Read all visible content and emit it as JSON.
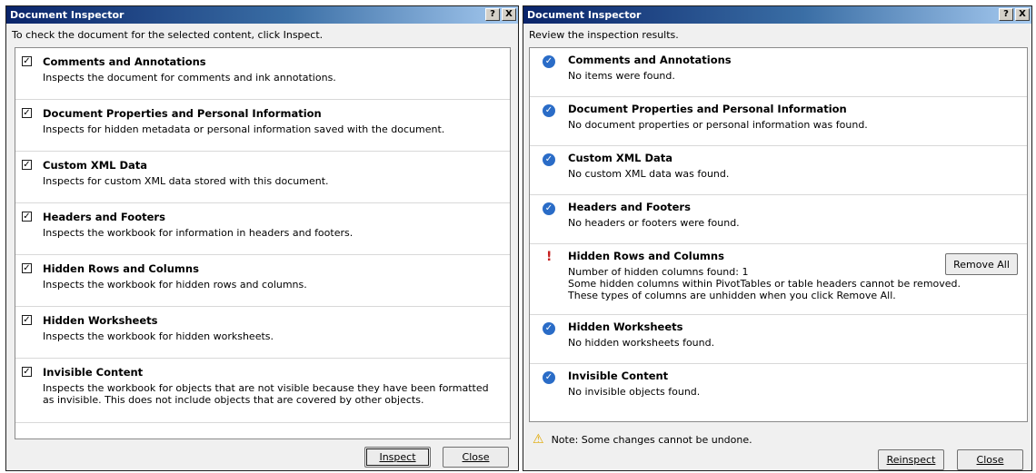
{
  "left_dialog": {
    "title": "Document Inspector",
    "help_btn": "?",
    "close_x": "X",
    "instruction": "To check the document for the selected content, click Inspect.",
    "items": [
      {
        "heading": "Comments and Annotations",
        "desc": "Inspects the document for comments and ink annotations."
      },
      {
        "heading": "Document Properties and Personal Information",
        "desc": "Inspects for hidden metadata or personal information saved with the document."
      },
      {
        "heading": "Custom XML Data",
        "desc": "Inspects for custom XML data stored with this document."
      },
      {
        "heading": "Headers and Footers",
        "desc": "Inspects the workbook for information in headers and footers."
      },
      {
        "heading": "Hidden Rows and Columns",
        "desc": "Inspects the workbook for hidden rows and columns."
      },
      {
        "heading": "Hidden Worksheets",
        "desc": "Inspects the workbook for hidden worksheets."
      },
      {
        "heading": "Invisible Content",
        "desc": "Inspects the workbook for objects that are not visible because they have been formatted as invisible. This does not include objects that are covered by other objects."
      }
    ],
    "check_mark": "✓",
    "inspect_label": "Inspect",
    "close_label": "Close"
  },
  "right_dialog": {
    "title": "Document Inspector",
    "help_btn": "?",
    "close_x": "X",
    "instruction": "Review the inspection results.",
    "items": [
      {
        "heading": "Comments and Annotations",
        "desc": "No items were found."
      },
      {
        "heading": "Document Properties and Personal Information",
        "desc": "No document properties or personal information was found."
      },
      {
        "heading": "Custom XML Data",
        "desc": "No custom XML data was found."
      },
      {
        "heading": "Headers and Footers",
        "desc": "No headers or footers were found."
      },
      {
        "heading": "Hidden Rows and Columns",
        "desc1": "Number of hidden columns found: 1",
        "desc2": "Some hidden columns within PivotTables or table headers cannot be removed.",
        "desc3": "These types of columns are unhidden when you click Remove All."
      },
      {
        "heading": "Hidden Worksheets",
        "desc": "No hidden worksheets found."
      },
      {
        "heading": "Invisible Content",
        "desc": "No invisible objects found."
      }
    ],
    "ok_mark": "✓",
    "warn_mark": "!",
    "remove_all_label": "Remove All",
    "note_icon": "⚠",
    "note": "Note: Some changes cannot be undone.",
    "reinspect_label": "Reinspect",
    "close_label": "Close"
  },
  "icons": {
    "checkbox": "checkbox-icon",
    "ok": "check-circle-icon",
    "warn": "exclamation-icon",
    "note": "warning-triangle-icon"
  },
  "colors": {
    "title_gradient_start": "#0a246a",
    "ok_icon": "#2a6cc7",
    "exclaim": "#c62020",
    "warning": "#e0a800"
  }
}
